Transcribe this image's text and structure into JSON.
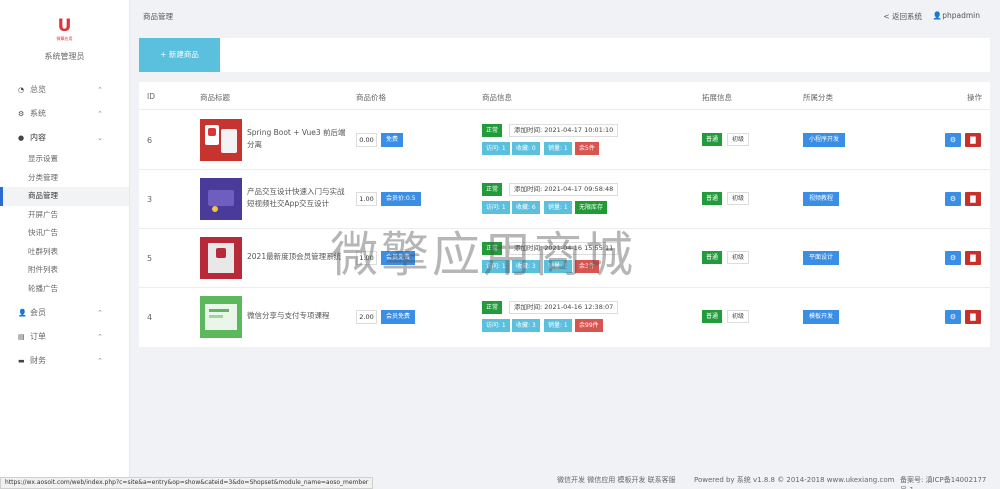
{
  "sidebar": {
    "logo_letter": "U",
    "logo_sub": "微擎应用",
    "title": "系统管理员",
    "nav": [
      {
        "icon": "pie-chart-icon",
        "label": "总览",
        "chev": "^"
      },
      {
        "icon": "gear-icon",
        "label": "系统",
        "chev": "^"
      },
      {
        "icon": "location-pin-icon",
        "label": "内容",
        "chev": "v"
      }
    ],
    "sub": [
      {
        "label": "显示设置"
      },
      {
        "label": "分类管理"
      },
      {
        "label": "商品管理"
      },
      {
        "label": "开屏广告"
      },
      {
        "label": "快讯广告"
      },
      {
        "label": "吐群列表"
      },
      {
        "label": "附件列表"
      },
      {
        "label": "轮播广告"
      }
    ],
    "nav2": [
      {
        "icon": "user-icon",
        "label": "会员",
        "chev": "^"
      },
      {
        "icon": "order-icon",
        "label": "订单",
        "chev": "^"
      },
      {
        "icon": "wallet-icon",
        "label": "财务",
        "chev": "^"
      }
    ]
  },
  "topbar": {
    "breadcrumb": "商品管理",
    "back_label": "< 返回系统",
    "user_label": "phpadmin"
  },
  "toolbar": {
    "add_label": "+ 新建商品"
  },
  "table": {
    "headers": {
      "id": "ID",
      "title": "商品标题",
      "price": "商品价格",
      "info": "商品信息",
      "ext": "拓展信息",
      "category": "所属分类",
      "ops": "操作"
    },
    "rows": [
      {
        "id": "6",
        "title": "Spring Boot + Vue3 前后端分离",
        "price": "0.00",
        "price_tag": "免费",
        "status": "正常",
        "added": "添加时间: 2021-04-17 10:01:10",
        "visits": "访问: 1",
        "favs": "收藏: 0",
        "sales": "销量: 1",
        "stock": "余5件",
        "stock_color": "red",
        "level": "普通",
        "grade": "初级",
        "category": "小程序开发",
        "thumb_color": "#c7342f"
      },
      {
        "id": "3",
        "title": "产品交互设计快速入门与实战 短视频社交App交互设计",
        "price": "1.00",
        "price_tag": "会员价:0.5",
        "status": "正常",
        "added": "添加时间: 2021-04-17 09:58:48",
        "visits": "访问: 1",
        "favs": "收藏: 6",
        "sales": "销量: 1",
        "stock": "无限库存",
        "stock_color": "darkgreen",
        "level": "普通",
        "grade": "初级",
        "category": "视频教程",
        "thumb_color": "#4a3a9a"
      },
      {
        "id": "5",
        "title": "2021最新度顶会员管理系统",
        "price": "1.00",
        "price_tag": "会员免费",
        "status": "正常",
        "added": "添加时间: 2021-04-16 15:55:11",
        "visits": "访问: 1",
        "favs": "收藏: 3",
        "sales": "销量: 1",
        "stock": "余3件",
        "stock_color": "red",
        "level": "普通",
        "grade": "初级",
        "category": "平面设计",
        "thumb_color": "#b8293a"
      },
      {
        "id": "4",
        "title": "微信分享与支付专项课程",
        "price": "2.00",
        "price_tag": "会员免费",
        "status": "正常",
        "added": "添加时间: 2021-04-16 12:38:07",
        "visits": "访问: 1",
        "favs": "收藏: 3",
        "sales": "销量: 1",
        "stock": "余99件",
        "stock_color": "red",
        "level": "普通",
        "grade": "初级",
        "category": "模板开发",
        "thumb_color": "#5cb85c"
      }
    ]
  },
  "watermark": "微擎应用商城",
  "footer": {
    "url": "https://wx.aosoit.com/web/index.php?c=site&a=entry&op=show&cateid=3&do=Shopset&module_name=aoso_member",
    "links": "微信开发  微信应用  模板开发  联系客服",
    "power": "Powered by 系统 v1.8.8 © 2014-2018 www.ukexiang.com",
    "icp": "备案号: 滇ICP备14002177号-1"
  }
}
